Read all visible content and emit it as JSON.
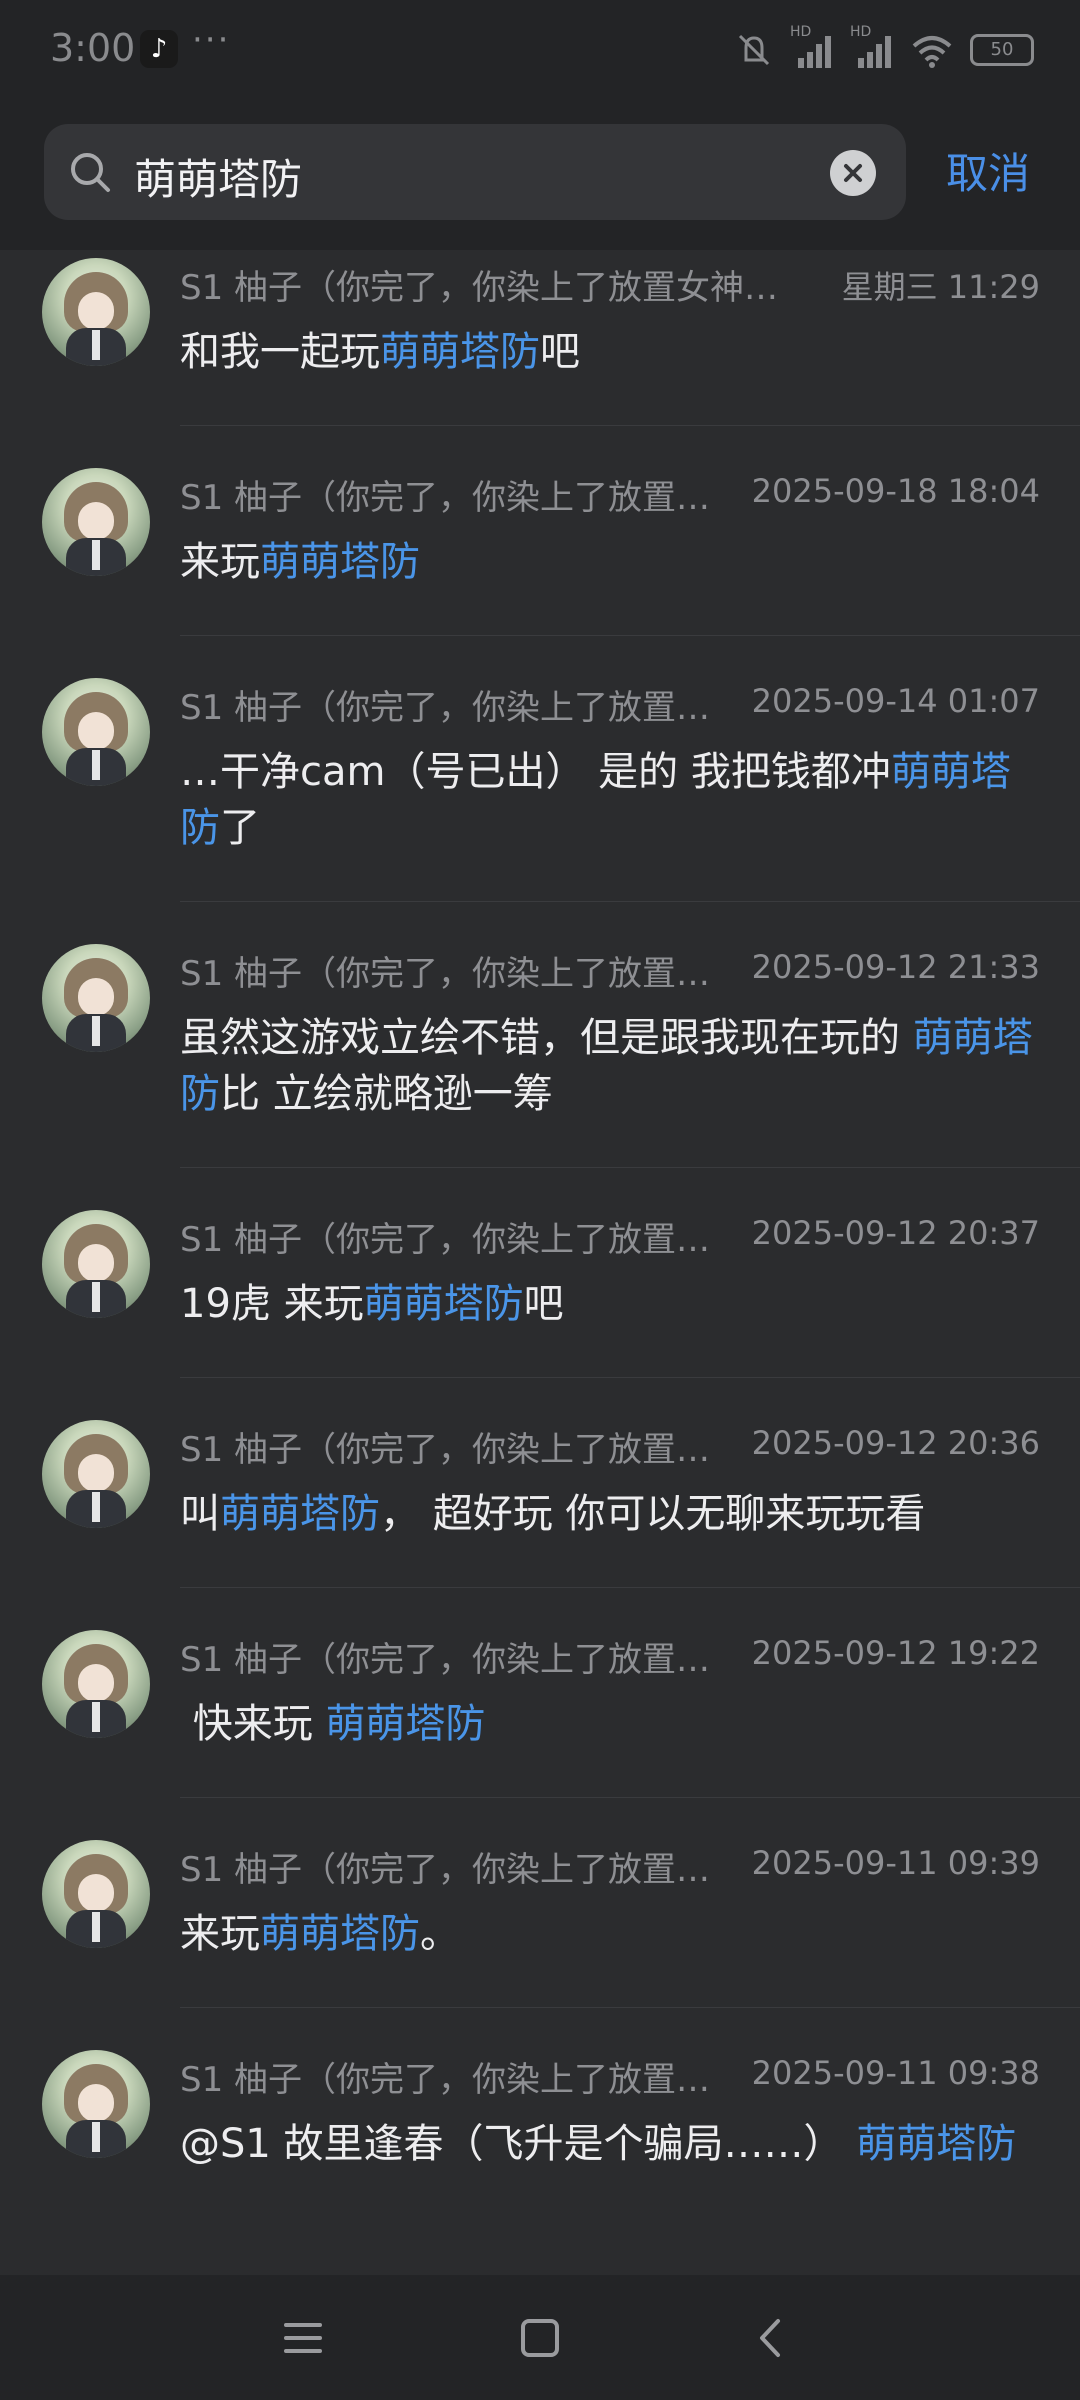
{
  "status": {
    "time": "3:00",
    "tiktok_glyph": "♪",
    "more": "···",
    "signal_1_label": "HD",
    "signal_2_label": "HD",
    "battery": "50"
  },
  "search": {
    "query": "萌萌塔防",
    "cancel_label": "取消"
  },
  "results": [
    {
      "sender": "S1 柚子（你完了，你染上了放置女神…",
      "time": "星期三 11:29",
      "pre": "和我一起玩",
      "hl": "萌萌塔防",
      "post": "吧"
    },
    {
      "sender": "S1 柚子（你完了，你染上了放置…",
      "time": "2025-09-18 18:04",
      "pre": "来玩",
      "hl": "萌萌塔防",
      "post": ""
    },
    {
      "sender": "S1 柚子（你完了，你染上了放置…",
      "time": "2025-09-14 01:07",
      "pre": "…干净cam（号已出）  是的 我把钱都冲",
      "hl": "萌萌塔防",
      "post": "了"
    },
    {
      "sender": "S1 柚子（你完了，你染上了放置…",
      "time": "2025-09-12 21:33",
      "pre": "虽然这游戏立绘不错，但是跟我现在玩的 ",
      "hl": "萌萌塔防",
      "post": "比  立绘就略逊一筹"
    },
    {
      "sender": "S1 柚子（你完了，你染上了放置…",
      "time": "2025-09-12 20:37",
      "pre": "19虎 来玩",
      "hl": "萌萌塔防",
      "post": "吧"
    },
    {
      "sender": "S1 柚子（你完了，你染上了放置…",
      "time": "2025-09-12 20:36",
      "pre": "叫",
      "hl": "萌萌塔防",
      "post": "， 超好玩  你可以无聊来玩玩看"
    },
    {
      "sender": "S1 柚子（你完了，你染上了放置…",
      "time": "2025-09-12 19:22",
      "pre": " 快来玩 ",
      "hl": "萌萌塔防",
      "post": ""
    },
    {
      "sender": "S1 柚子（你完了，你染上了放置…",
      "time": "2025-09-11 09:39",
      "pre": "来玩",
      "hl": "萌萌塔防",
      "post": "。"
    },
    {
      "sender": "S1 柚子（你完了，你染上了放置…",
      "time": "2025-09-11 09:38",
      "pre": "@S1 故里逢春（飞升是个骗局……）  ",
      "hl": "萌萌塔防",
      "post": ""
    }
  ],
  "colors": {
    "background": "#2b2c2e",
    "highlight": "#4a95e8",
    "accent": "#4a8fe7"
  }
}
